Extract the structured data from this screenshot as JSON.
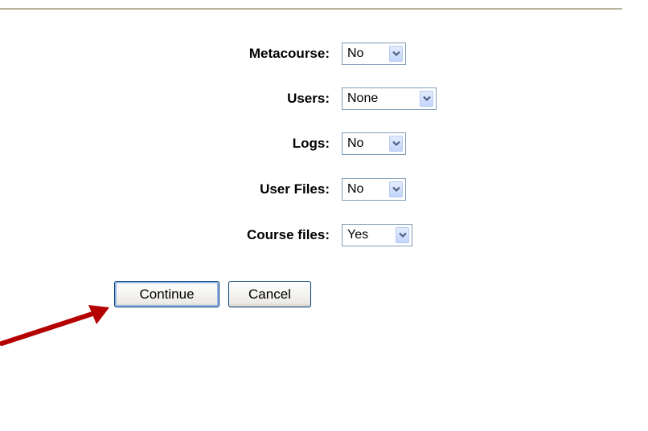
{
  "form": {
    "fields": [
      {
        "label": "Metacourse:",
        "value": "No"
      },
      {
        "label": "Users:",
        "value": "None"
      },
      {
        "label": "Logs:",
        "value": "No"
      },
      {
        "label": "User Files:",
        "value": "No"
      },
      {
        "label": "Course files:",
        "value": "Yes"
      }
    ]
  },
  "buttons": {
    "continue_label": "Continue",
    "cancel_label": "Cancel"
  },
  "icons": {
    "dropdown": "chevron-down-icon",
    "annotation": "annotation-arrow"
  },
  "colors": {
    "annotation_arrow": "#b40000",
    "select_border": "#7f9db9",
    "divider": "#b8b49c"
  }
}
